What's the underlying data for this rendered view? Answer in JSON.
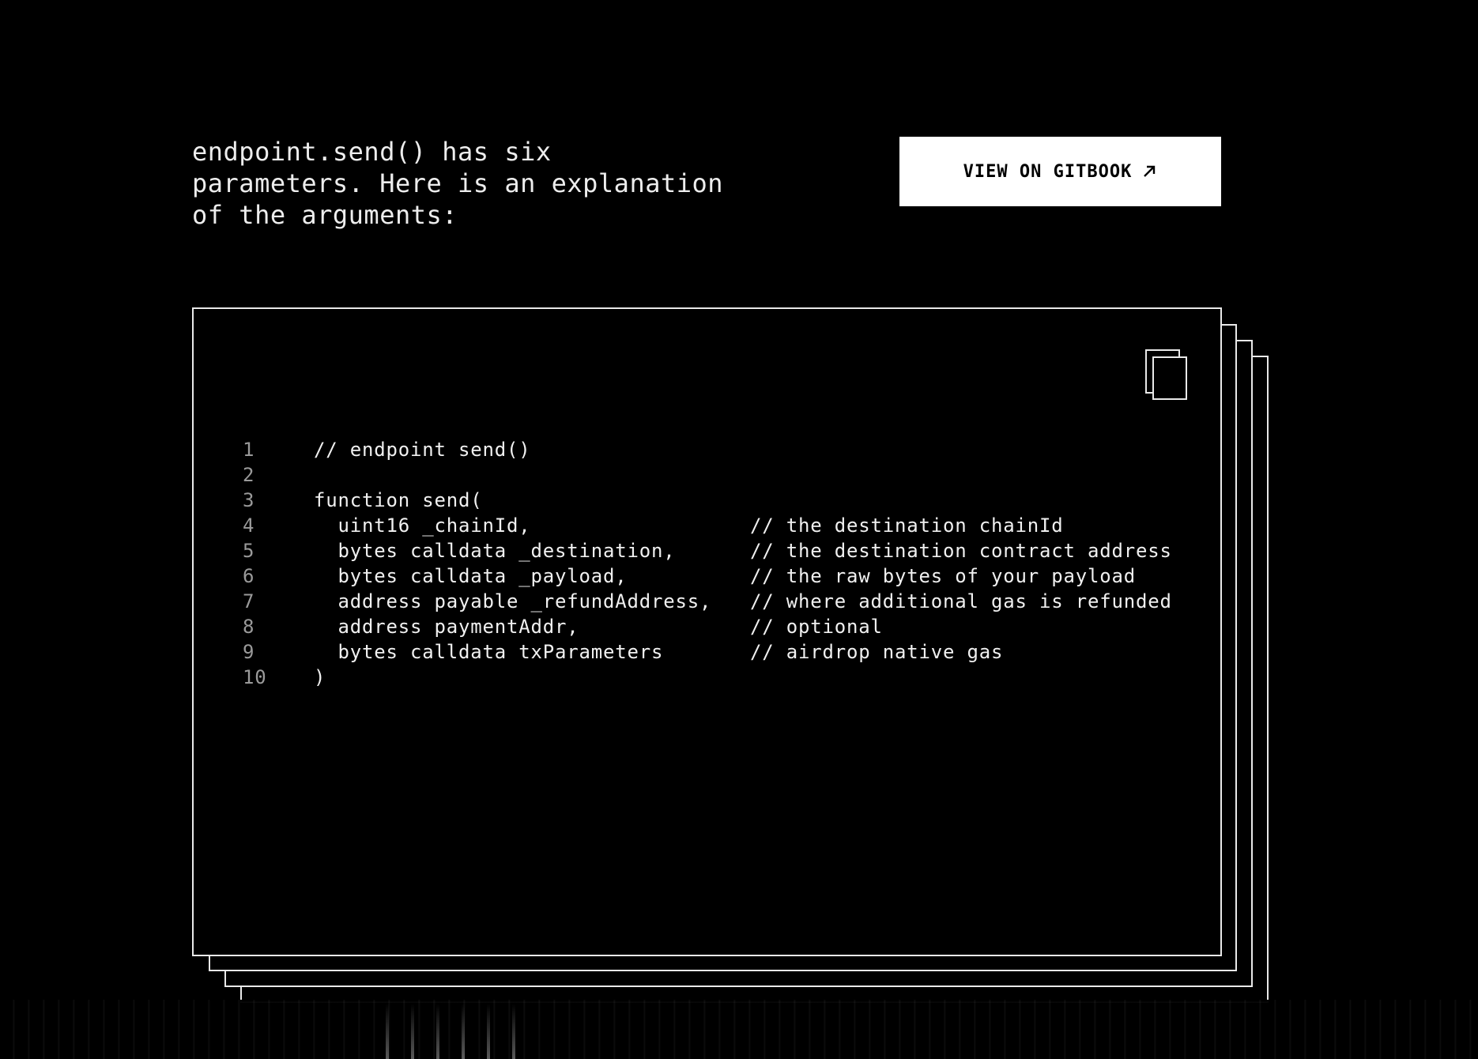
{
  "intro": {
    "text": "endpoint.send() has six parameters. Here is an explanation of the arguments:"
  },
  "gitbook_button": {
    "label": "VIEW ON GITBOOK",
    "icon": "arrow-up-right-icon"
  },
  "code_card": {
    "copy_icon": "copy-icon",
    "lines": [
      {
        "num": "1",
        "code": "// endpoint send()",
        "comment": ""
      },
      {
        "num": "2",
        "code": "",
        "comment": ""
      },
      {
        "num": "3",
        "code": "function send(",
        "comment": ""
      },
      {
        "num": "4",
        "code": "  uint16 _chainId,",
        "comment": "// the destination chainId"
      },
      {
        "num": "5",
        "code": "  bytes calldata _destination,",
        "comment": "// the destination contract address"
      },
      {
        "num": "6",
        "code": "  bytes calldata _payload,",
        "comment": "// the raw bytes of your payload"
      },
      {
        "num": "7",
        "code": "  address payable _refundAddress,",
        "comment": "// where additional gas is refunded"
      },
      {
        "num": "8",
        "code": "  address paymentAddr,",
        "comment": "// optional"
      },
      {
        "num": "9",
        "code": "  bytes calldata txParameters",
        "comment": "// airdrop native gas"
      },
      {
        "num": "10",
        "code": ")",
        "comment": ""
      }
    ]
  },
  "colors": {
    "background": "#000000",
    "text": "#f0f0f0",
    "line_number": "#9a9a9a",
    "button_bg": "#ffffff",
    "button_text": "#000000"
  }
}
